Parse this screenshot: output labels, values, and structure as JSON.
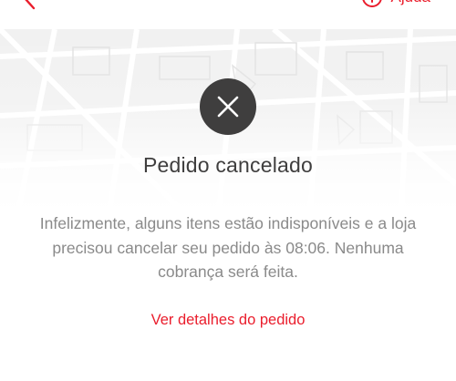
{
  "header": {
    "help_label": "Ajuda"
  },
  "order": {
    "title": "Pedido cancelado",
    "message": "Infelizmente, alguns itens estão indisponíveis e a loja precisou cancelar seu pedido às 08:06. Nenhuma cobrança será feita.",
    "details_link": "Ver detalhes do pedido"
  },
  "icons": {
    "back": "chevron-left-icon",
    "help": "help-circle-icon",
    "status": "close-icon"
  },
  "colors": {
    "accent": "#ea1d2c",
    "title": "#3f3e3e",
    "body_text": "#8a8a8a",
    "status_circle": "#3f3e3e"
  }
}
